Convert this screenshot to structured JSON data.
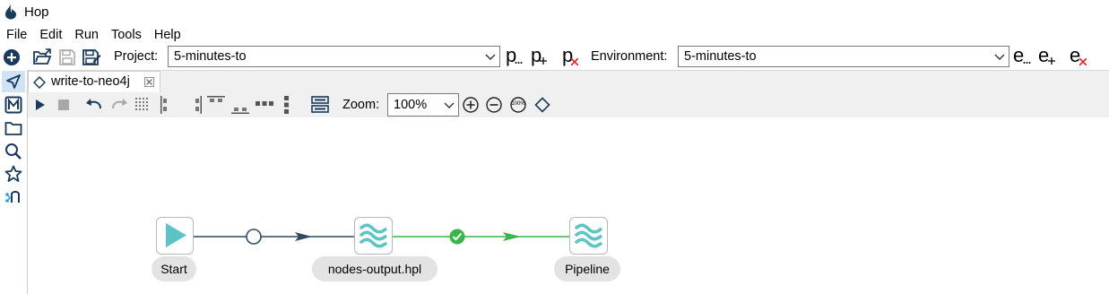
{
  "window": {
    "title": "Hop"
  },
  "menu": [
    "File",
    "Edit",
    "Run",
    "Tools",
    "Help"
  ],
  "toolbar": {
    "project_label": "Project:",
    "project_value": "5-minutes-to",
    "environment_label": "Environment:",
    "environment_value": "5-minutes-to",
    "project_buttons": {
      "edit": "p",
      "add": "p",
      "delete": "p"
    },
    "environment_buttons": {
      "edit": "e",
      "add": "e",
      "delete": "e"
    }
  },
  "tab": {
    "label": "write-to-neo4j"
  },
  "pipeline_toolbar": {
    "zoom_label": "Zoom:",
    "zoom_value": "100%",
    "zoom_100_label": "100%"
  },
  "canvas": {
    "nodes": [
      {
        "name": "Start",
        "icon": "start-play-icon"
      },
      {
        "name": "nodes-output.hpl",
        "icon": "pipeline-waves-icon"
      },
      {
        "name": "Pipeline",
        "icon": "pipeline-waves-icon"
      }
    ],
    "hops": [
      {
        "from": "Start",
        "to": "nodes-output.hpl",
        "condition": "unconditional"
      },
      {
        "from": "nodes-output.hpl",
        "to": "Pipeline",
        "condition": "success"
      }
    ]
  },
  "colors": {
    "accent": "#1a3a5c",
    "hop_unconditional": "#2f4a63",
    "hop_success": "#39b54a",
    "node_icon": "#5cc3c7",
    "delete_red": "#e02020"
  }
}
